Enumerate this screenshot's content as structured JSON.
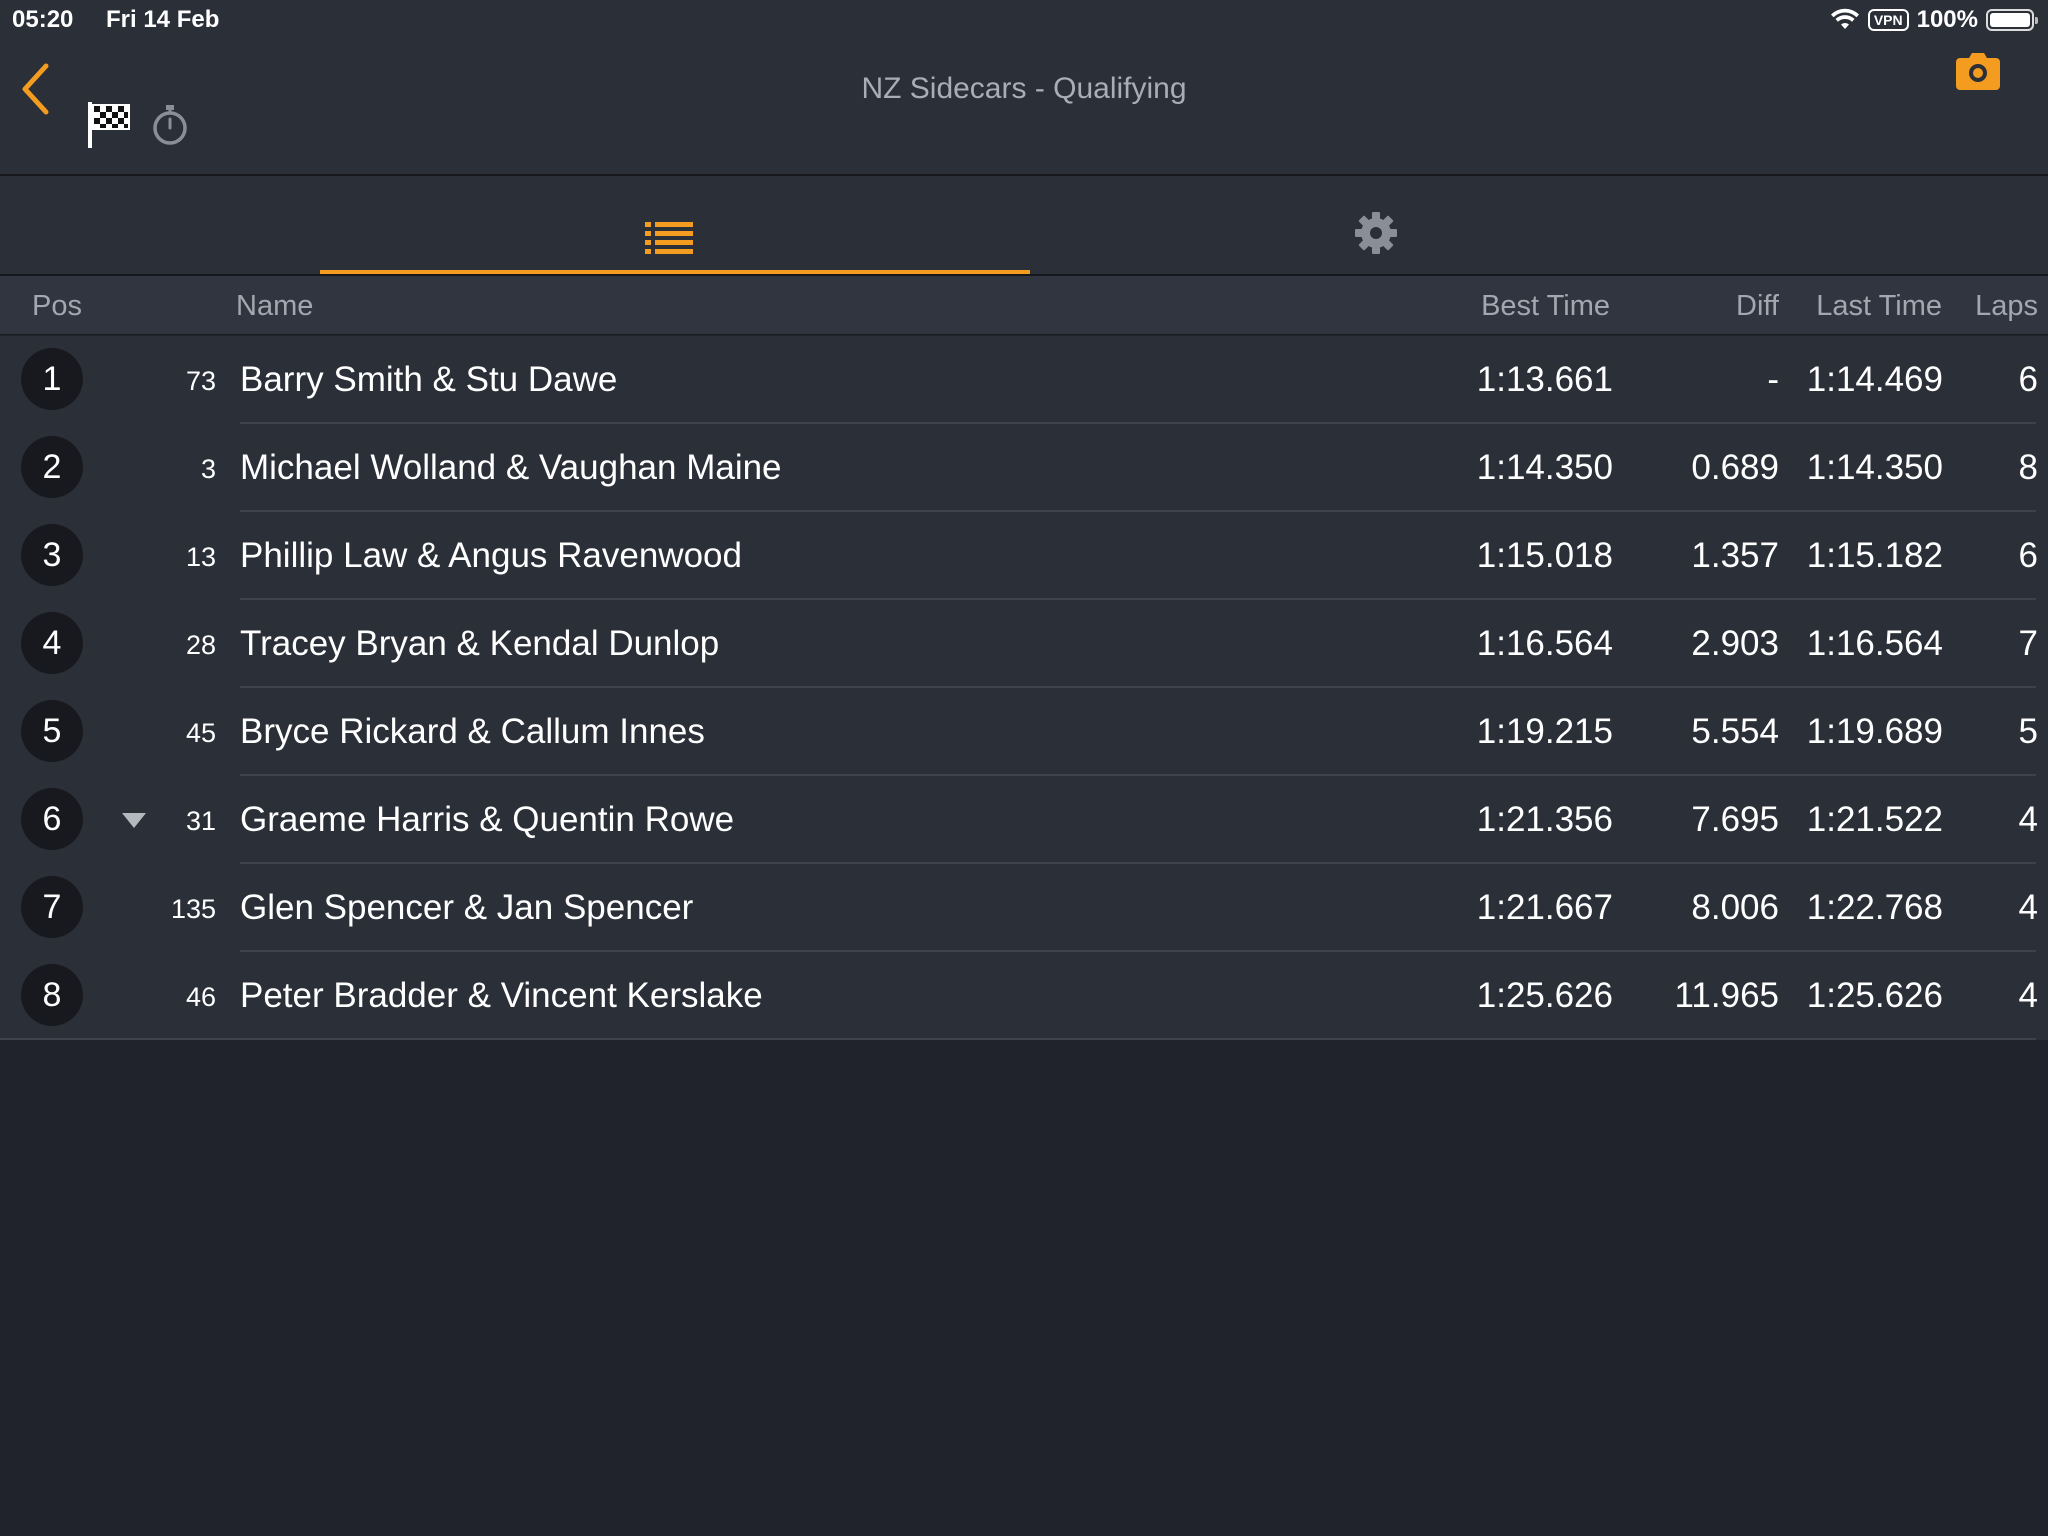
{
  "status_bar": {
    "time": "05:20",
    "date": "Fri 14 Feb",
    "vpn_label": "VPN",
    "battery_percent": "100%",
    "battery_level": 1.0
  },
  "nav": {
    "title": "NZ Sidecars - Qualifying",
    "icons": [
      "back-chevron-icon",
      "checkered-flag-icon",
      "stopwatch-icon",
      "camera-icon"
    ]
  },
  "tabs": {
    "items": [
      {
        "name": "list",
        "icon": "list-icon",
        "active": true
      },
      {
        "name": "settings",
        "icon": "gear-icon",
        "active": false
      }
    ]
  },
  "table": {
    "headers": {
      "pos": "Pos",
      "name": "Name",
      "best_time": "Best Time",
      "diff": "Diff",
      "last_time": "Last Time",
      "laps": "Laps"
    },
    "rows": [
      {
        "pos": "1",
        "num": "73",
        "name": "Barry Smith & Stu Dawe",
        "best": "1:13.661",
        "diff": "-",
        "last": "1:14.469",
        "laps": "6",
        "trend": ""
      },
      {
        "pos": "2",
        "num": "3",
        "name": "Michael Wolland & Vaughan Maine",
        "best": "1:14.350",
        "diff": "0.689",
        "last": "1:14.350",
        "laps": "8",
        "trend": ""
      },
      {
        "pos": "3",
        "num": "13",
        "name": "Phillip Law & Angus Ravenwood",
        "best": "1:15.018",
        "diff": "1.357",
        "last": "1:15.182",
        "laps": "6",
        "trend": ""
      },
      {
        "pos": "4",
        "num": "28",
        "name": "Tracey Bryan & Kendal Dunlop",
        "best": "1:16.564",
        "diff": "2.903",
        "last": "1:16.564",
        "laps": "7",
        "trend": ""
      },
      {
        "pos": "5",
        "num": "45",
        "name": "Bryce Rickard & Callum Innes",
        "best": "1:19.215",
        "diff": "5.554",
        "last": "1:19.689",
        "laps": "5",
        "trend": ""
      },
      {
        "pos": "6",
        "num": "31",
        "name": "Graeme Harris & Quentin Rowe",
        "best": "1:21.356",
        "diff": "7.695",
        "last": "1:21.522",
        "laps": "4",
        "trend": "down"
      },
      {
        "pos": "7",
        "num": "135",
        "name": "Glen Spencer & Jan Spencer",
        "best": "1:21.667",
        "diff": "8.006",
        "last": "1:22.768",
        "laps": "4",
        "trend": ""
      },
      {
        "pos": "8",
        "num": "46",
        "name": "Peter Bradder & Vincent Kerslake",
        "best": "1:25.626",
        "diff": "11.965",
        "last": "1:25.626",
        "laps": "4",
        "trend": ""
      }
    ]
  },
  "colors": {
    "accent": "#f39c1f",
    "background": "#20232b",
    "panel": "#2b2f38",
    "header_text": "#a3a7b0"
  }
}
